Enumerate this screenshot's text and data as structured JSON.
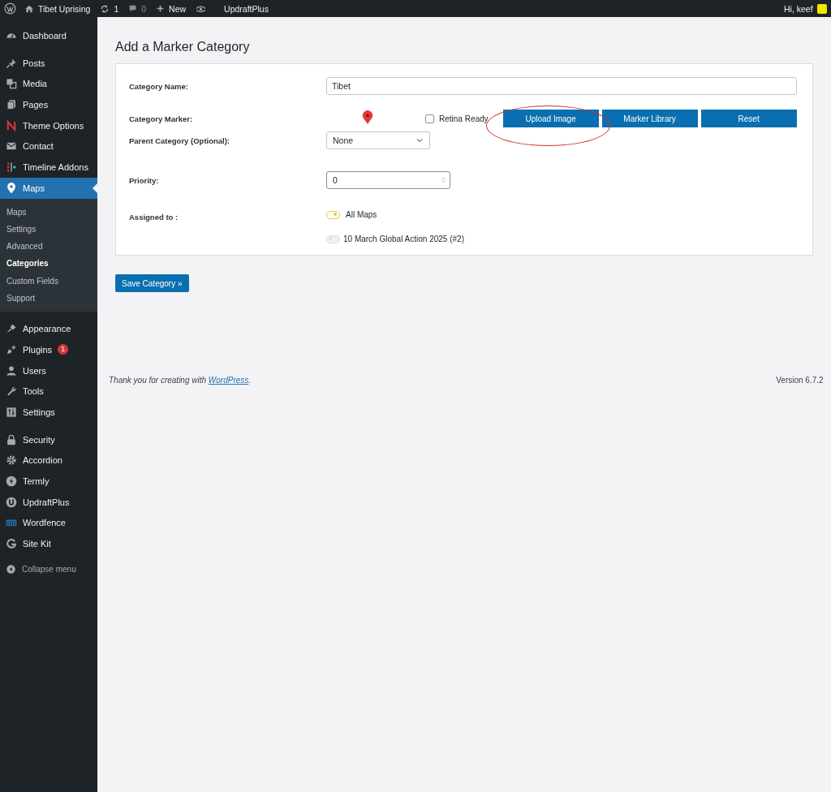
{
  "admin_bar": {
    "site_name": "Tibet Uprising",
    "updates_count": "1",
    "comments_count": "0",
    "new_label": "New",
    "plugin_label": "UpdraftPlus",
    "greeting": "Hi, keef"
  },
  "sidebar": {
    "groups": [
      [
        {
          "label": "Dashboard",
          "selected": false
        }
      ],
      [
        {
          "label": "Posts",
          "selected": false
        },
        {
          "label": "Media",
          "selected": false
        },
        {
          "label": "Pages",
          "selected": false
        },
        {
          "label": "Theme Options",
          "selected": false
        },
        {
          "label": "Contact",
          "selected": false
        },
        {
          "label": "Timeline Addons",
          "selected": false
        },
        {
          "label": "Maps",
          "selected": true,
          "children": [
            {
              "label": "Maps",
              "selected": false
            },
            {
              "label": "Settings",
              "selected": false
            },
            {
              "label": "Advanced",
              "selected": false
            },
            {
              "label": "Categories",
              "selected": true
            },
            {
              "label": "Custom Fields",
              "selected": false
            },
            {
              "label": "Support",
              "selected": false
            }
          ]
        }
      ],
      [
        {
          "label": "Appearance",
          "selected": false
        },
        {
          "label": "Plugins",
          "selected": false,
          "badge": "1"
        },
        {
          "label": "Users",
          "selected": false
        },
        {
          "label": "Tools",
          "selected": false
        },
        {
          "label": "Settings",
          "selected": false
        }
      ],
      [
        {
          "label": "Security",
          "selected": false
        },
        {
          "label": "Accordion",
          "selected": false
        },
        {
          "label": "Termly",
          "selected": false
        },
        {
          "label": "UpdraftPlus",
          "selected": false
        },
        {
          "label": "Wordfence",
          "selected": false
        },
        {
          "label": "Site Kit",
          "selected": false
        }
      ]
    ],
    "collapse_label": "Collapse menu"
  },
  "page": {
    "title": "Add a Marker Category",
    "form": {
      "name_label": "Category Name:",
      "name_value": "Tibet",
      "marker_label": "Category Marker:",
      "retina_label": "Retina Ready",
      "retina_checked": false,
      "marker_buttons": [
        "Upload Image",
        "Marker Library",
        "Reset"
      ],
      "parent_label": "Parent Category (Optional):",
      "parent_value": "None",
      "priority_label": "Priority:",
      "priority_value": "0",
      "assigned_label": "Assigned to :",
      "maps": [
        {
          "label": "All Maps",
          "on": true
        },
        {
          "label": "10 March Global Action 2025 (#2)",
          "on": false
        }
      ]
    },
    "save_label": "Save Category »"
  },
  "footer": {
    "text_before": "Thank you for creating with ",
    "link": "WordPress",
    "text_after": ".",
    "version": "Version 6.7.2"
  }
}
